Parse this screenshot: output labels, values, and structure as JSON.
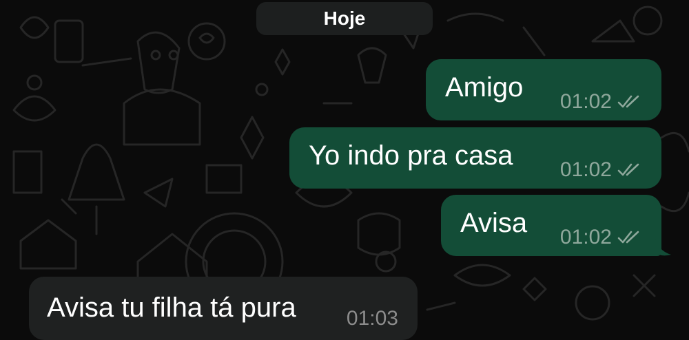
{
  "date_chip": "Hoje",
  "messages": [
    {
      "text": "Amigo",
      "time": "01:02",
      "direction": "outgoing",
      "status_icon": "double-check-icon"
    },
    {
      "text": "Yo indo pra casa",
      "time": "01:02",
      "direction": "outgoing",
      "status_icon": "double-check-icon"
    },
    {
      "text": "Avisa",
      "time": "01:02",
      "direction": "outgoing",
      "status_icon": "double-check-icon"
    },
    {
      "text": "Avisa tu filha tá pura",
      "time": "01:03",
      "direction": "incoming"
    }
  ],
  "colors": {
    "background": "#0b0b0b",
    "outgoing_bubble": "#134d37",
    "incoming_bubble": "#1f2121",
    "date_chip": "#1d1f1f",
    "meta_outgoing": "#8fa89c",
    "meta_incoming": "#8c8c8c"
  }
}
